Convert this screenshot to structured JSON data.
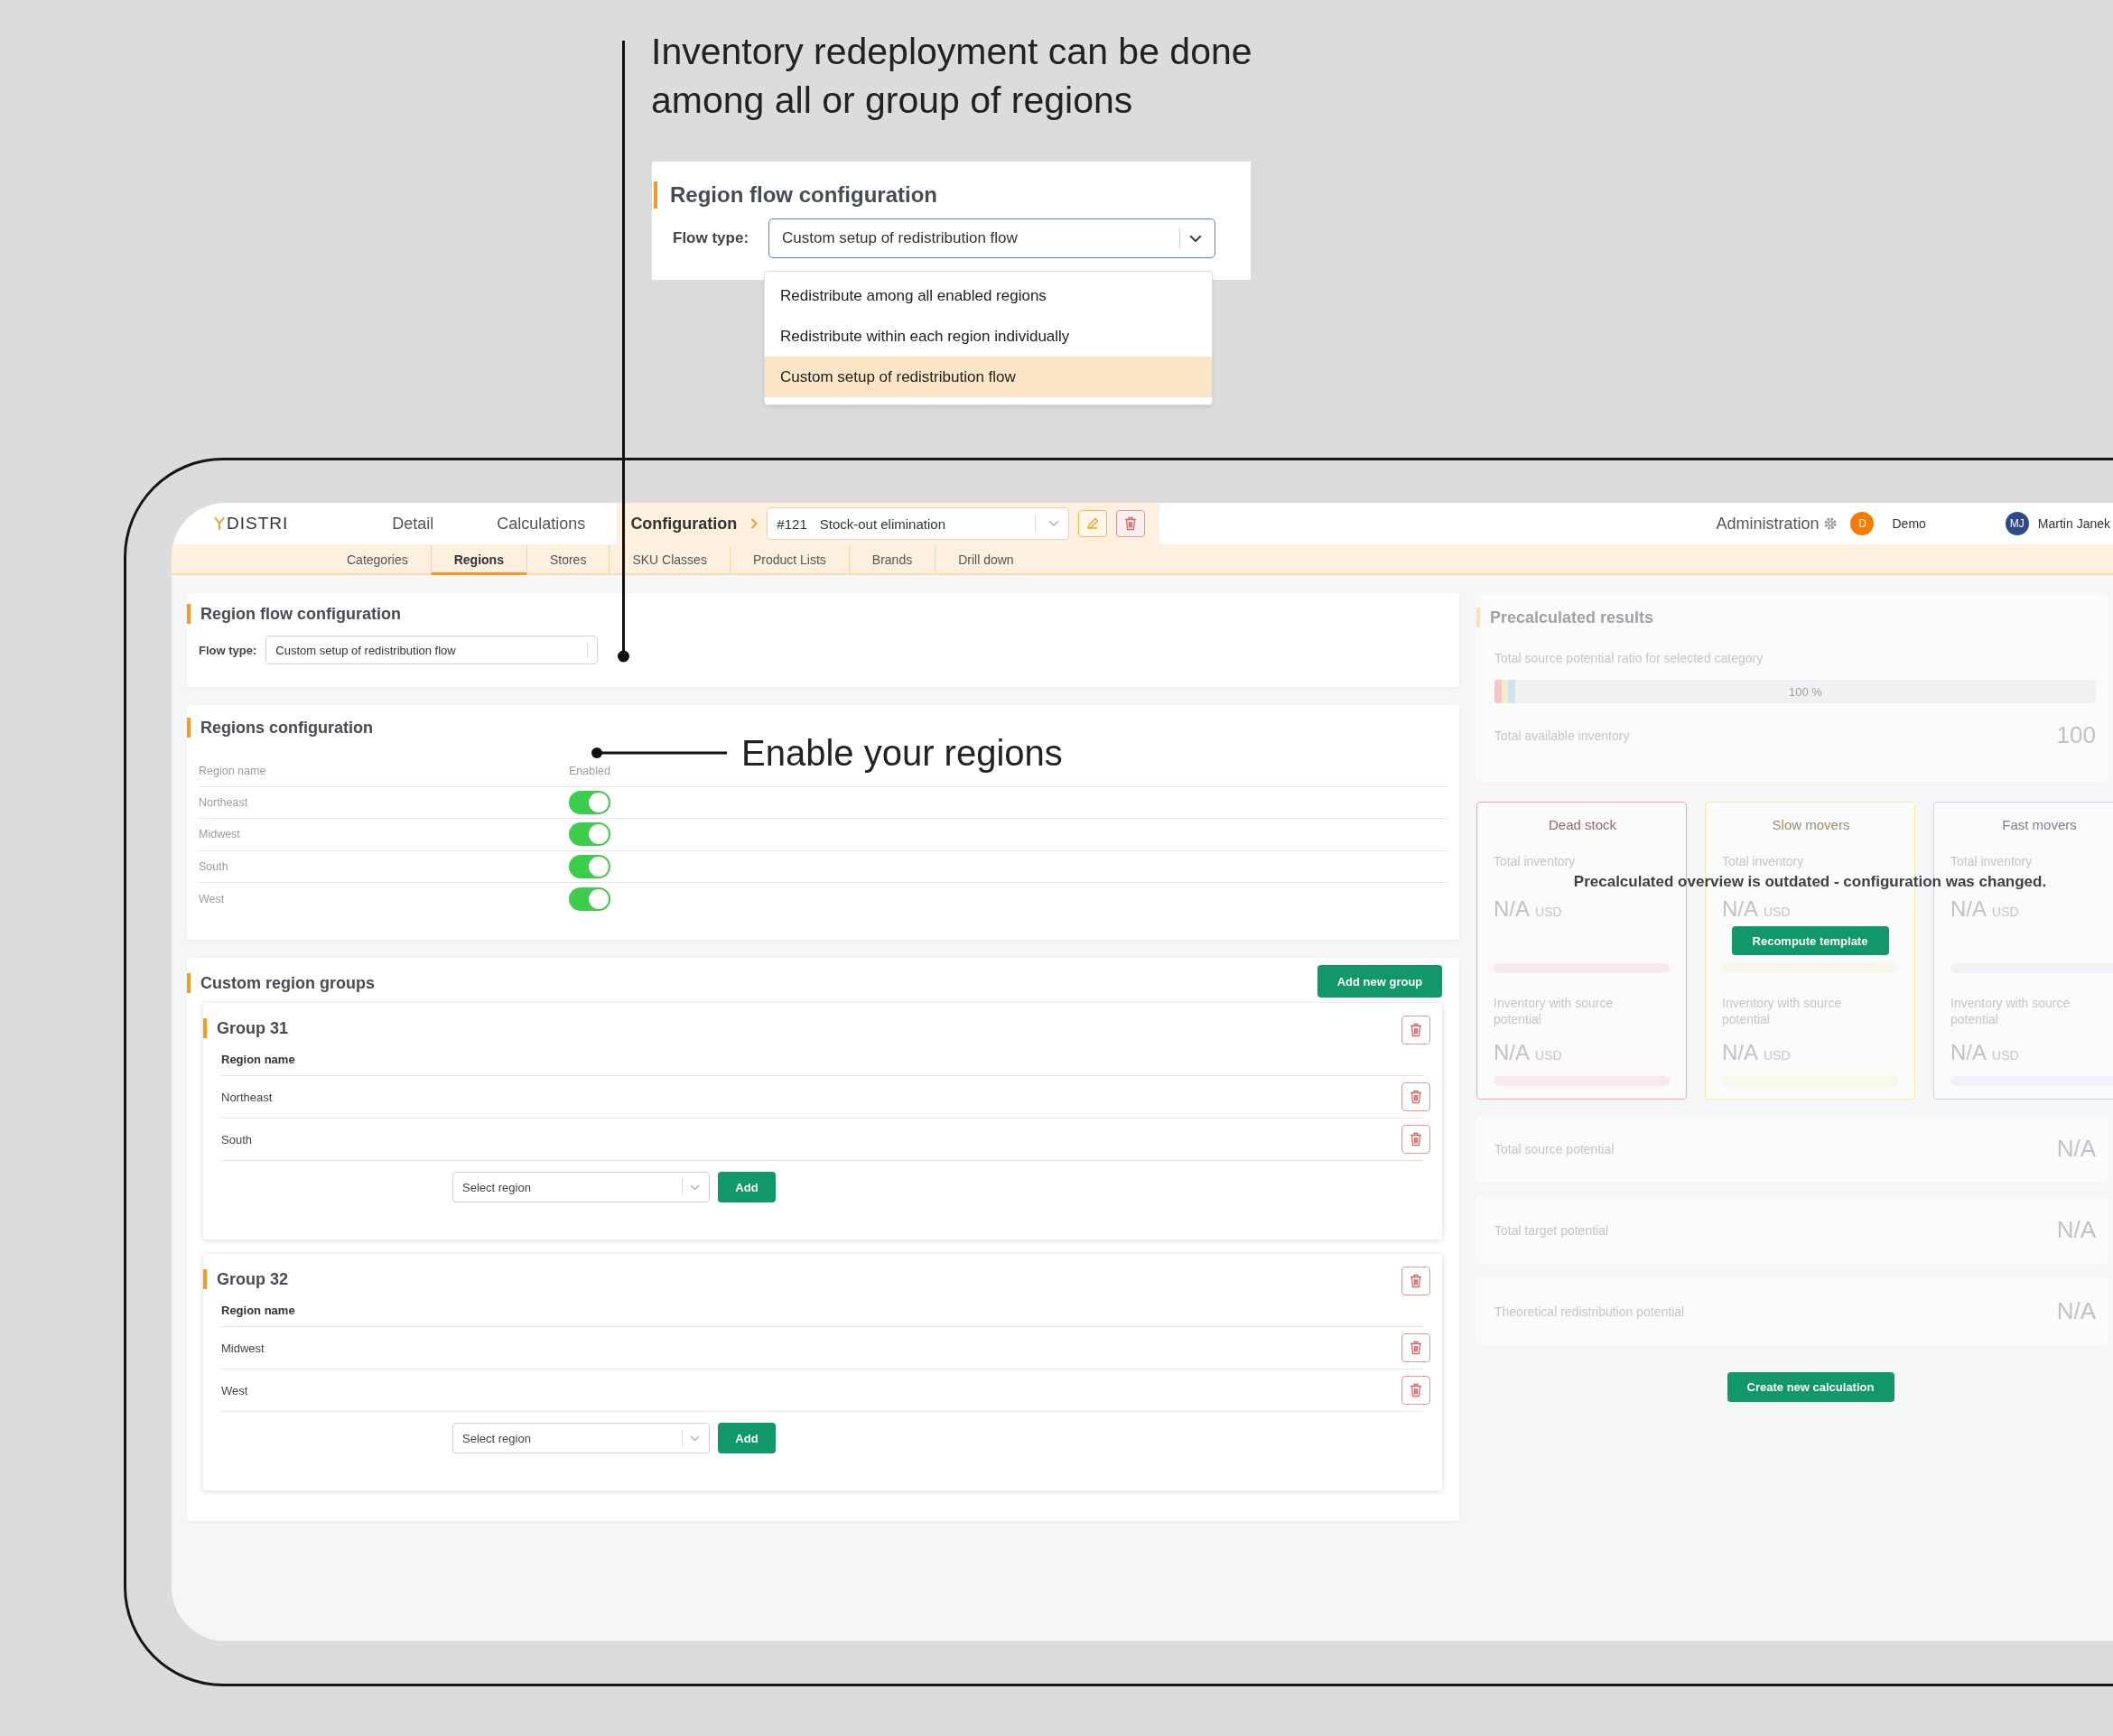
{
  "headline": "Inventory redeployment can be done among all or group of regions",
  "regions_note": "Enable your regions",
  "callout": {
    "title": "Region flow configuration",
    "flow_label": "Flow type:",
    "value": "Custom setup of redistribution flow",
    "options": [
      {
        "label": "Redistribute among all enabled regions",
        "selected": false
      },
      {
        "label": "Redistribute within each region individually",
        "selected": false
      },
      {
        "label": "Custom setup of redistribution flow",
        "selected": true
      }
    ]
  },
  "header": {
    "logo": "DISTRI",
    "nav": [
      {
        "label": "Detail",
        "selected": false
      },
      {
        "label": "Calculations",
        "selected": false
      },
      {
        "label": "Configuration",
        "selected": true
      }
    ],
    "calc_number": "#121",
    "calc_name": "Stock-out elimination",
    "admin": "Administration",
    "workspace_initial": "D",
    "workspace": "Demo",
    "user_initials": "MJ",
    "user_name": "Martin Janek"
  },
  "subtabs": [
    {
      "label": "Categories",
      "selected": false
    },
    {
      "label": "Regions",
      "selected": true
    },
    {
      "label": "Stores",
      "selected": false
    },
    {
      "label": "SKU Classes",
      "selected": false
    },
    {
      "label": "Product Lists",
      "selected": false
    },
    {
      "label": "Brands",
      "selected": false
    },
    {
      "label": "Drill down",
      "selected": false
    }
  ],
  "flow_panel": {
    "title": "Region flow configuration",
    "flow_label": "Flow type:",
    "value": "Custom setup of redistribution flow"
  },
  "regions_panel": {
    "title": "Regions configuration",
    "columns": [
      "Region name",
      "Enabled"
    ],
    "rows": [
      {
        "name": "Northeast",
        "on": true
      },
      {
        "name": "Midwest",
        "on": true
      },
      {
        "name": "South",
        "on": true
      },
      {
        "name": "West",
        "on": true
      }
    ]
  },
  "groups_panel": {
    "title": "Custom region groups",
    "add_button": "Add new group",
    "groups": [
      {
        "title": "Group 31",
        "column": "Region name",
        "regions": [
          "Northeast",
          "South"
        ],
        "placeholder": "Select region",
        "add_button": "Add"
      },
      {
        "title": "Group 32",
        "column": "Region name",
        "regions": [
          "Midwest",
          "West"
        ],
        "placeholder": "Select region",
        "add_button": "Add"
      }
    ]
  },
  "results": {
    "title": "Precalculated results",
    "ratio_label": "Total source potential ratio for selected category",
    "ratio_value": "100 %",
    "available_label": "Total available inventory",
    "available_value": "100",
    "cards": [
      {
        "title": "Dead stock",
        "color": "#f2a7a7",
        "total_label": "Total inventory",
        "total_value": "N/A",
        "total_unit": "USD",
        "source_label": "Inventory with source potential",
        "source_value": "N/A",
        "source_unit": "USD"
      },
      {
        "title": "Slow movers",
        "color": "#f6eaa6",
        "total_label": "Total inventory",
        "total_value": "N/A",
        "total_unit": "USD",
        "source_label": "Inventory with source potential",
        "source_value": "N/A",
        "source_unit": "USD"
      },
      {
        "title": "Fast movers",
        "color": "#c9d0ea",
        "total_label": "Total inventory",
        "total_value": "N/A",
        "total_unit": "USD",
        "source_label": "Inventory with source potential",
        "source_value": "N/A",
        "source_unit": "USD"
      }
    ],
    "outdated_message": "Precalculated overview is outdated - configuration was changed.",
    "recompute_button": "Recompute template",
    "rows": [
      {
        "label": "Total source potential",
        "value": "N/A"
      },
      {
        "label": "Total target potential",
        "value": "N/A"
      },
      {
        "label": "Theoretical redistribution potential",
        "value": "N/A"
      }
    ],
    "create_button": "Create new calculation"
  }
}
